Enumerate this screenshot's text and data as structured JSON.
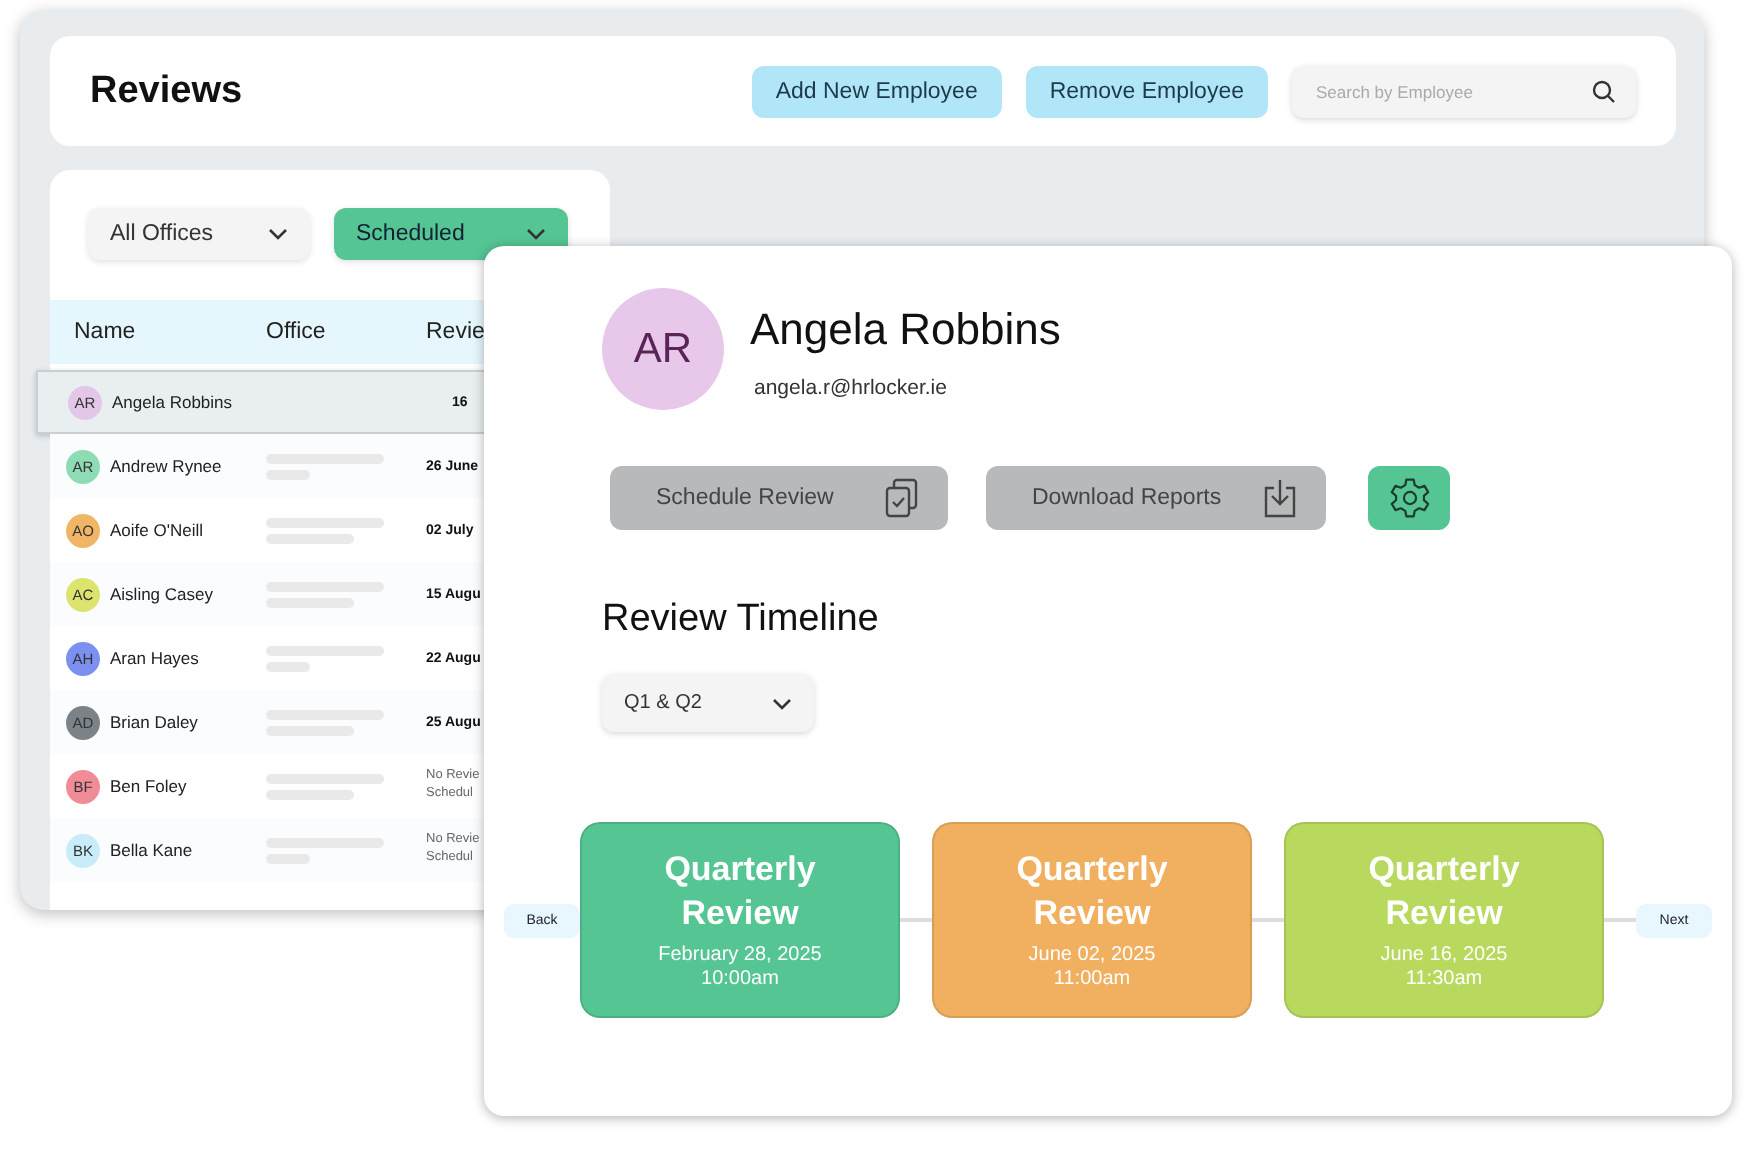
{
  "header": {
    "title": "Reviews",
    "buttons": [
      "Add New Employee",
      "Remove Employee"
    ],
    "search": {
      "placeholder": "Search by Employee"
    }
  },
  "filters": [
    {
      "label": "All Offices",
      "selected": false
    },
    {
      "label": "Scheduled",
      "selected": true
    }
  ],
  "table": {
    "columns": [
      "Name",
      "Office",
      "Revie"
    ],
    "rows": [
      {
        "initials": "AR",
        "name": "Angela Robbins",
        "color": "#e3c6e8",
        "review": [
          "16"
        ],
        "office_bars": false,
        "selected": true
      },
      {
        "initials": "AR",
        "name": "Andrew Rynee",
        "color": "#8edcb4",
        "review": [
          "26 June"
        ],
        "office_bars": true,
        "selected": false
      },
      {
        "initials": "AO",
        "name": "Aoife O'Neill",
        "color": "#f0b666",
        "review": [
          "02 July"
        ],
        "office_bars": true,
        "selected": false
      },
      {
        "initials": "AC",
        "name": "Aisling Casey",
        "color": "#dde46e",
        "review": [
          "15 Augu"
        ],
        "office_bars": true,
        "selected": false
      },
      {
        "initials": "AH",
        "name": "Aran Hayes",
        "color": "#7b90f0",
        "review": [
          "22 Augu"
        ],
        "office_bars": true,
        "selected": false
      },
      {
        "initials": "AD",
        "name": "Brian Daley",
        "color": "#7b8288",
        "review": [
          "25 Augu"
        ],
        "office_bars": true,
        "selected": false
      },
      {
        "initials": "BF",
        "name": "Ben Foley",
        "color": "#f08c98",
        "review": [
          "No Revie",
          "Schedul"
        ],
        "office_bars": true,
        "selected": false
      },
      {
        "initials": "BK",
        "name": "Bella Kane",
        "color": "#c8ecf8",
        "review": [
          "No Revie",
          "Schedul"
        ],
        "office_bars": true,
        "selected": false
      }
    ]
  },
  "profile": {
    "initials": "AR",
    "name": "Angela Robbins",
    "email": "angela.r@hrlocker.ie",
    "color": "#e8c8ea",
    "actions": [
      {
        "kind": "clipboard",
        "label": "Schedule Review"
      },
      {
        "kind": "download",
        "label": "Download Reports"
      },
      {
        "kind": "settings"
      }
    ]
  },
  "timeline": {
    "title": "Review Timeline",
    "period": "Q1 & Q2",
    "back": "Back",
    "next": "Next",
    "events": [
      {
        "title": "Quarterly Review",
        "date": "February 28, 2025",
        "time": "10:00am",
        "color": "#55c594"
      },
      {
        "title": "Quarterly Review",
        "date": "June 02, 2025",
        "time": "11:00am",
        "color": "#f0b060"
      },
      {
        "title": "Quarterly Review",
        "date": "June 16, 2025",
        "time": "11:30am",
        "color": "#b8d95e"
      }
    ]
  }
}
